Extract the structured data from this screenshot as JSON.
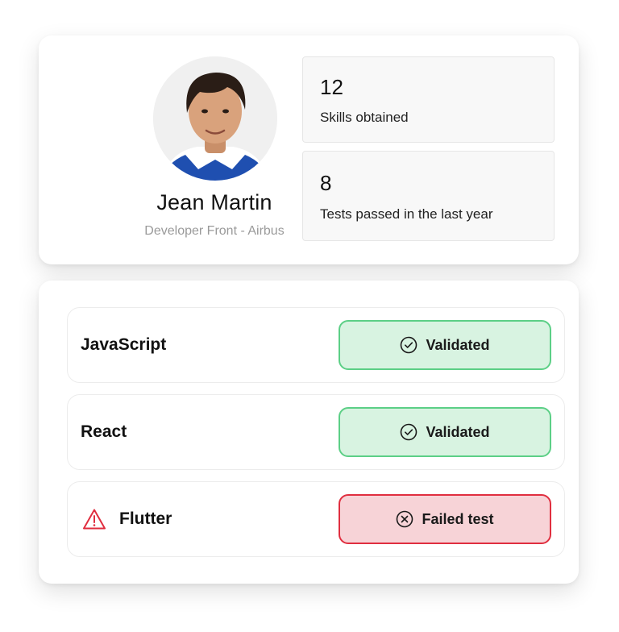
{
  "profile": {
    "name": "Jean Martin",
    "role": "Developer Front - Airbus",
    "avatar_icon": "person-photo"
  },
  "stats": [
    {
      "value": "12",
      "label": "Skills obtained"
    },
    {
      "value": "8",
      "label": "Tests passed in the last year"
    }
  ],
  "skills": [
    {
      "name": "JavaScript",
      "status": "Validated",
      "status_icon": "check-circle-icon",
      "state": "ok"
    },
    {
      "name": "React",
      "status": "Validated",
      "status_icon": "check-circle-icon",
      "state": "ok"
    },
    {
      "name": "Flutter",
      "status": "Failed test",
      "status_icon": "x-circle-icon",
      "state": "fail",
      "warning_icon": "warning-triangle-icon"
    }
  ],
  "colors": {
    "validated_bg": "#d8f3e1",
    "validated_border": "#5ccf86",
    "failed_bg": "#f7d3d7",
    "failed_border": "#e02e3f",
    "warning": "#e02e3f"
  }
}
